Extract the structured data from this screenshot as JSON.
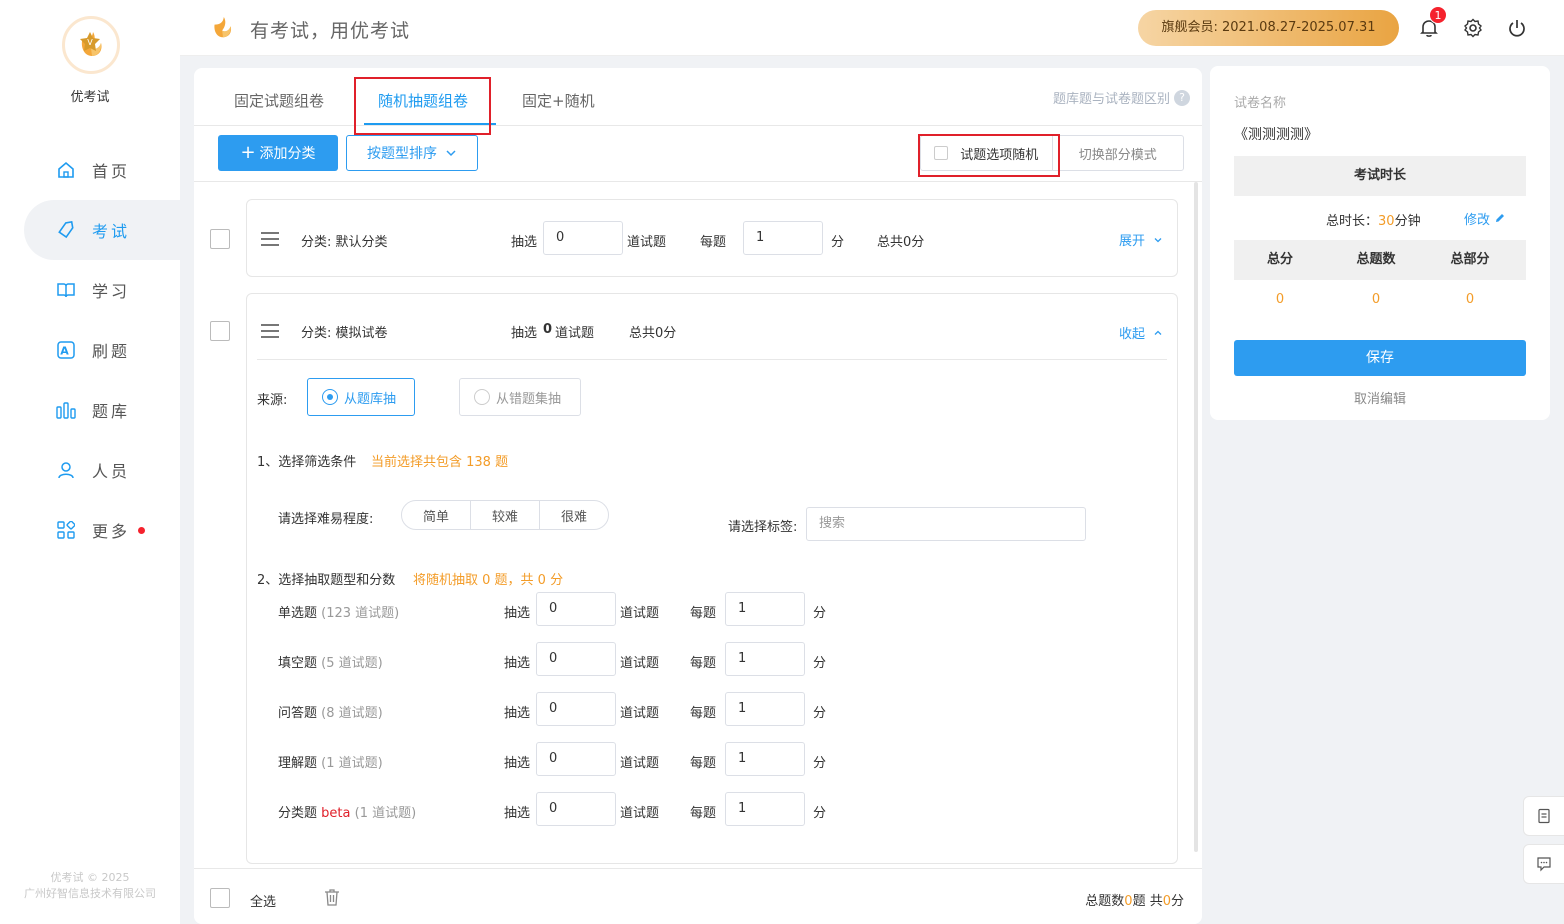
{
  "app": {
    "brand": "优考试",
    "slogan": "有考试，用优考试",
    "copyright_line1": "优考试 © 2025",
    "copyright_line2": "广州好智信息技术有限公司"
  },
  "sidebar": {
    "items": [
      {
        "label": "首页",
        "icon": "home-icon"
      },
      {
        "label": "考试",
        "icon": "tag-icon",
        "active": true
      },
      {
        "label": "学习",
        "icon": "book-icon"
      },
      {
        "label": "刷题",
        "icon": "letter-a-icon"
      },
      {
        "label": "题库",
        "icon": "bars-icon"
      },
      {
        "label": "人员",
        "icon": "user-icon"
      },
      {
        "label": "更多",
        "icon": "apps-icon",
        "dot": true
      }
    ]
  },
  "topbar": {
    "membership": "旗舰会员:  2021.08.27-2025.07.31",
    "notification_count": "1"
  },
  "tabs": [
    "固定试题组卷",
    "随机抽题组卷",
    "固定+随机"
  ],
  "help_link": "题库题与试卷题区别",
  "toolbar": {
    "add_category": "添加分类",
    "sort_by": "按题型排序",
    "random_options": "试题选项随机",
    "switch_mode": "切换部分模式"
  },
  "category1": {
    "name": "分类: 默认分类",
    "draw_label": "抽选",
    "draw_value": "0",
    "unit_label": "道试题",
    "per_label": "每题",
    "per_value": "1",
    "score_unit": "分",
    "total": "总共0分",
    "expand": "展开"
  },
  "category2": {
    "name": "分类: 模拟试卷",
    "summary_prefix": "抽选",
    "summary_count": "0",
    "summary_suffix": "道试题",
    "total": "总共0分",
    "collapse": "收起",
    "source_label": "来源:",
    "source_bank": "从题库抽",
    "source_wrong": "从错题集抽",
    "step1": "1、选择筛选条件",
    "step1_note": "当前选择共包含 138 题",
    "difficulty_label": "请选择难易程度:",
    "difficulty": [
      "简单",
      "较难",
      "很难"
    ],
    "tag_label": "请选择标签:",
    "tag_placeholder": "搜索",
    "step2": "2、选择抽取题型和分数",
    "step2_note": "将随机抽取 0 题，共 0 分",
    "types": [
      {
        "name": "单选题",
        "beta": "",
        "count": "(123 道试题)",
        "draw": "0",
        "per": "1"
      },
      {
        "name": "填空题",
        "beta": "",
        "count": "(5 道试题)",
        "draw": "0",
        "per": "1"
      },
      {
        "name": "问答题",
        "beta": "",
        "count": "(8 道试题)",
        "draw": "0",
        "per": "1"
      },
      {
        "name": "理解题",
        "beta": "",
        "count": "(1 道试题)",
        "draw": "0",
        "per": "1"
      },
      {
        "name": "分类题",
        "beta": "beta",
        "count": "(1 道试题)",
        "draw": "0",
        "per": "1"
      }
    ],
    "draw_label": "抽选",
    "unit_label": "道试题",
    "per_label": "每题",
    "score_unit": "分"
  },
  "bottom": {
    "select_all": "全选",
    "total_prefix": "总题数",
    "total_count": "0",
    "total_mid": "题 共",
    "total_score": "0",
    "total_suffix": "分"
  },
  "right_panel": {
    "name_label": "试卷名称",
    "name": "《测测测测》",
    "duration_header": "考试时长",
    "duration_prefix": "总时长：",
    "duration_value": "30",
    "duration_unit": "分钟",
    "edit": "修改",
    "score_headers": [
      "总分",
      "总题数",
      "总部分"
    ],
    "score_values": [
      "0",
      "0",
      "0"
    ],
    "save": "保存",
    "cancel": "取消编辑"
  },
  "colors": {
    "accent": "#2d9cf0",
    "orange": "#f39c28",
    "highlight_box": "#e0202a"
  }
}
